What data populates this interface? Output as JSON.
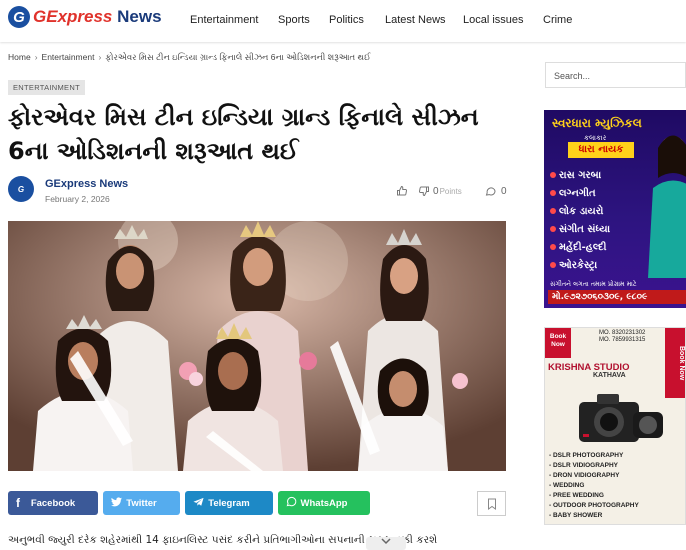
{
  "site": {
    "logo_letter": "G",
    "logo_g": "G",
    "logo_rest": "Express",
    "logo_news": " News"
  },
  "nav": [
    "Entertainment",
    "Sports",
    "Politics",
    "Latest News",
    "Local issues",
    "Crime"
  ],
  "breadcrumb": {
    "home": "Home",
    "category": "Entertainment",
    "current": "ફોરએવર મિસ ટીન ઇન્ડિયા ગ્રાન્ડ ફિનાલે સીઝન 6ના ઓડિશનની શરૂઆત થઈ"
  },
  "article": {
    "category": "ENTERTAINMENT",
    "title": "ફોરએવર મિસ ટીન ઇન્ડિયા ગ્રાન્ડ ફિનાલે સીઝન 6ના ઓડિશનની શરૂઆત થઈ",
    "author": "GExpress News",
    "date": "February 2, 2026",
    "likes": "",
    "dislikes": "0",
    "points_label": "Points",
    "comments": "0",
    "excerpt": "અનુભવી જ્યુરી દરેક શહેરમાંથી 14 ફાઇનલિસ્ટ પસંદ કરીને પ્રતિભાગીઓના સપનાની સફર નક્કી કરશે"
  },
  "share": {
    "facebook": "Facebook",
    "twitter": "Twitter",
    "telegram": "Telegram",
    "whatsapp": "WhatsApp"
  },
  "sidebar": {
    "search_placeholder": "Search...",
    "ad1": {
      "title": "સ્વરધારા મ્યુઝિકલ",
      "sub": "કલાકાર",
      "name": "ધારા નાયક",
      "items": [
        "રાસ ગરબા",
        "લગ્નગીત",
        "લોક ડાયરો",
        "સંગીત સંધ્યા",
        "મહેંદી-હલ્દી",
        "ઓરકેસ્ટ્રા"
      ],
      "note": "સંગીતને લગતા તમામ પ્રોગ્રામ માટે",
      "phone": "મો.૯૭૨૭૦૬૦૩૦૯, ૯૮૦૯"
    },
    "ad2": {
      "book_now": "Book Now",
      "mo1": "MO. 8320231302",
      "mo2": "MO. 7859931315",
      "studio": "KRISHNA STUDIO",
      "town": "KATHAVA",
      "services": [
        "- DSLR PHOTOGRAPHY",
        "- DSLR VIDIOGRAPHY",
        "- DRON VIDIOGRAPHY",
        "- WEDDING",
        "- PREE WEDDING",
        "- OUTDOOR PHOTOGRAPHY",
        "- BABY SHOWER"
      ]
    }
  },
  "colors": {
    "facebook": "#3b5998",
    "twitter": "#55acee",
    "telegram": "#1d89c6",
    "whatsapp": "#25c15e",
    "brand_red": "#e0322b",
    "brand_blue": "#1a3a7a"
  }
}
